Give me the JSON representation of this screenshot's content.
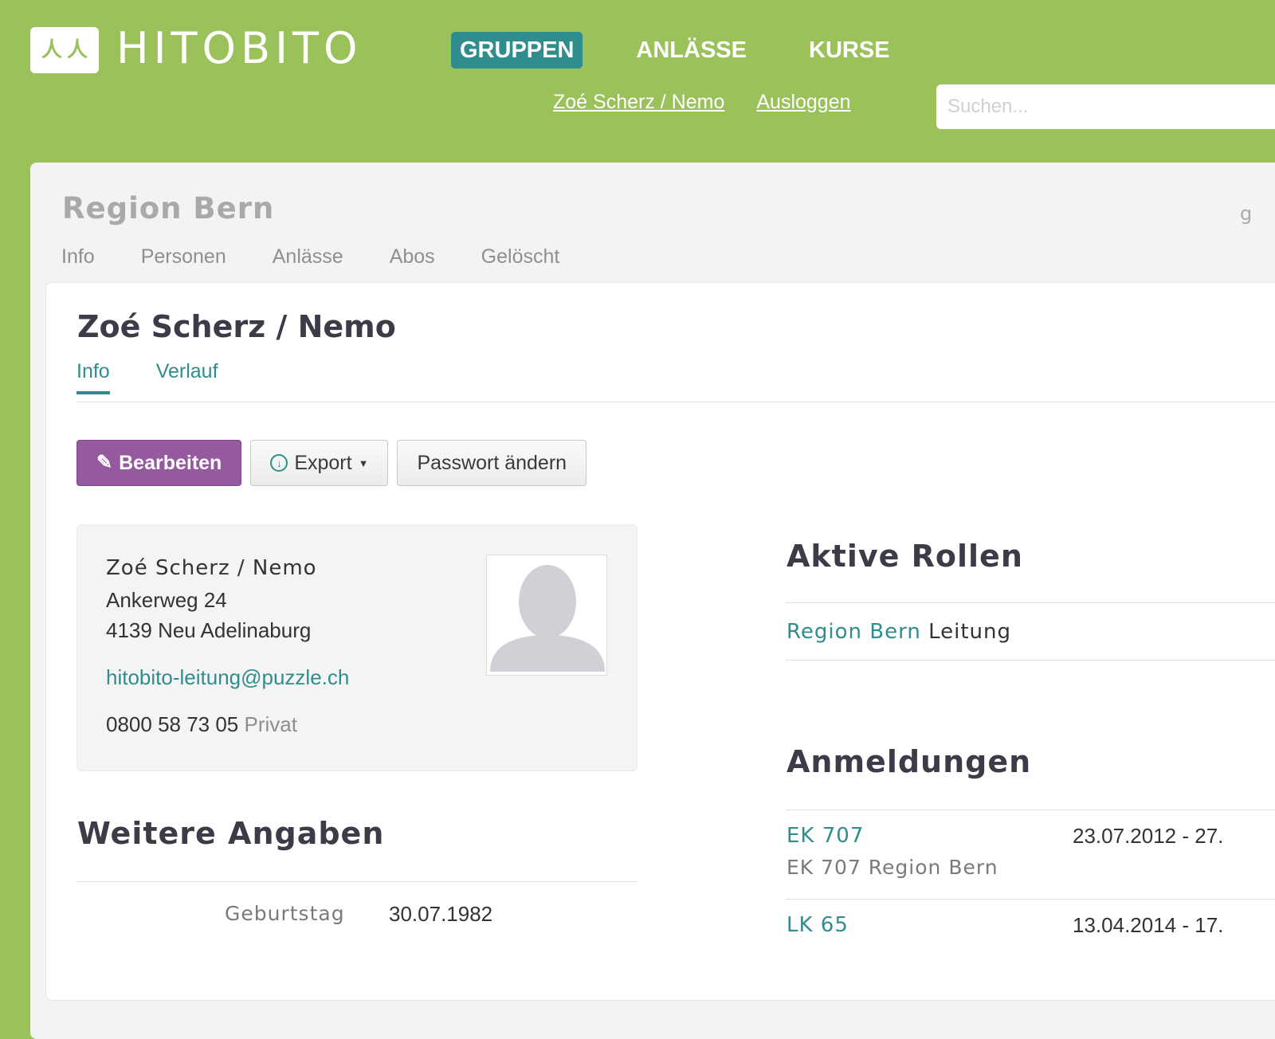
{
  "header": {
    "logo_icon": "people-icon",
    "logo_text": "HITOBITO",
    "nav": [
      {
        "label": "GRUPPEN",
        "active": true
      },
      {
        "label": "ANLÄSSE",
        "active": false
      },
      {
        "label": "KURSE",
        "active": false
      }
    ],
    "user_link": "Zoé Scherz / Nemo",
    "logout_link": "Ausloggen",
    "search_placeholder": "Suchen..."
  },
  "group": {
    "title": "Region Bern",
    "right_fragment": "g",
    "tabs": [
      "Info",
      "Personen",
      "Anlässe",
      "Abos",
      "Gelöscht"
    ]
  },
  "person": {
    "title": "Zoé Scherz / Nemo",
    "tabs": [
      {
        "label": "Info",
        "active": true
      },
      {
        "label": "Verlauf",
        "active": false
      }
    ],
    "buttons": {
      "edit": "Bearbeiten",
      "export": "Export",
      "password": "Passwort ändern"
    },
    "contact": {
      "name": "Zoé Scherz / Nemo",
      "street": "Ankerweg 24",
      "city": "4139 Neu Adelinaburg",
      "email": "hitobito-leitung@puzzle.ch",
      "phone": "0800 58 73 05",
      "phone_type": "Privat"
    },
    "weitere": {
      "heading": "Weitere Angaben",
      "birthday_label": "Geburtstag",
      "birthday_value": "30.07.1982"
    }
  },
  "roles": {
    "heading": "Aktive Rollen",
    "items": [
      {
        "group": "Region Bern",
        "role": "Leitung"
      }
    ]
  },
  "registrations": {
    "heading": "Anmeldungen",
    "items": [
      {
        "title": "EK 707",
        "subtitle": "EK 707 Region Bern",
        "date": "23.07.2012 - 27."
      },
      {
        "title": "LK 65",
        "subtitle": "",
        "date": "13.04.2014 - 17."
      }
    ]
  },
  "colors": {
    "header_bg": "#9bc15b",
    "accent": "#2f8d8d",
    "edit_button": "#955a9e"
  }
}
